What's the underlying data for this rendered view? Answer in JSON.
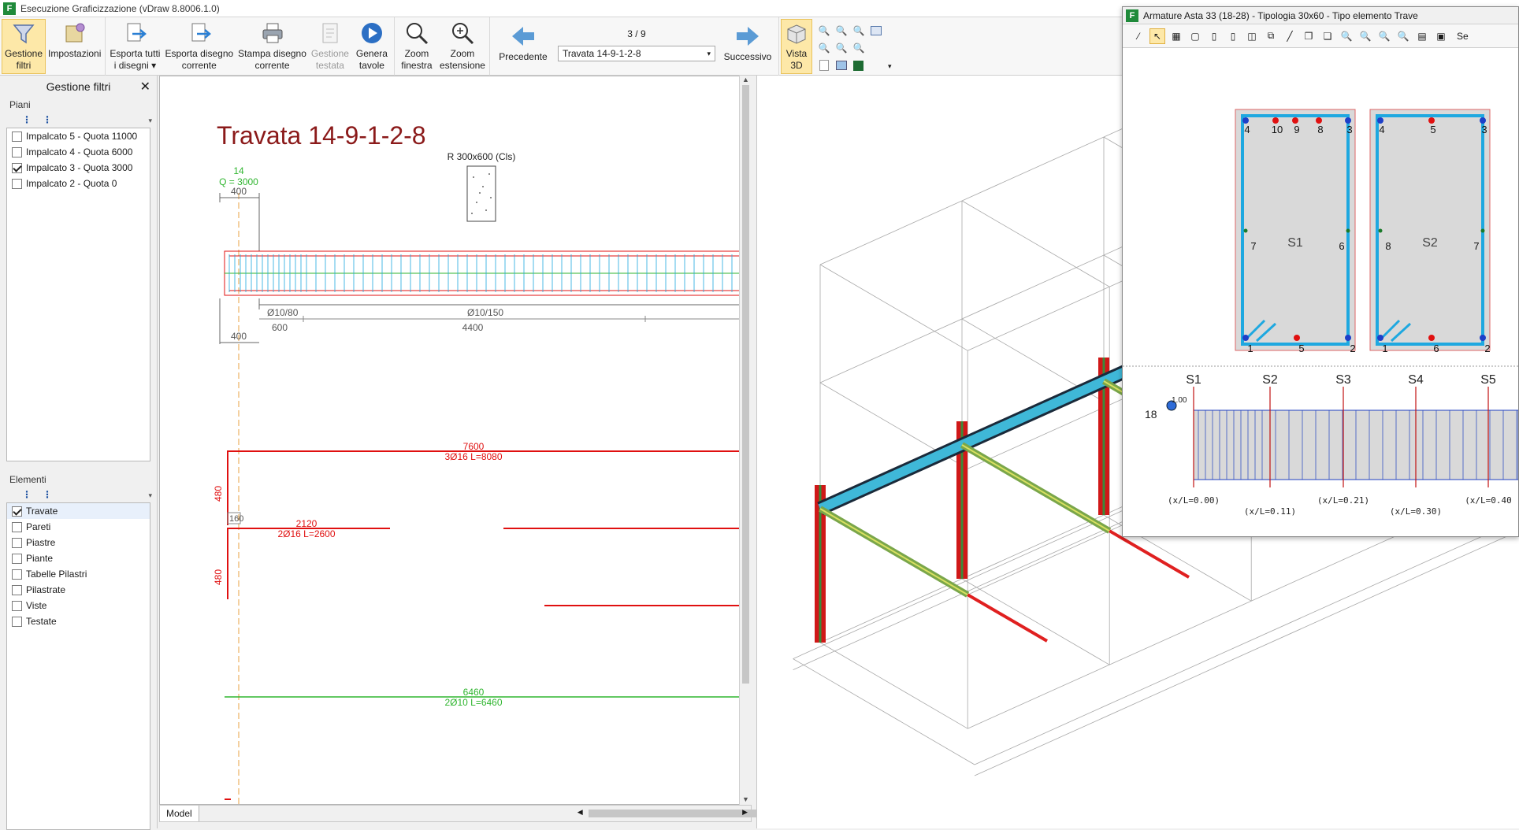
{
  "window": {
    "title": "Esecuzione Graficizzazione (vDraw 8.8006.1.0)",
    "icon_letter": "F"
  },
  "ribbon": {
    "buttons": [
      {
        "label1": "Gestione",
        "label2": "filtri",
        "icon": "filter-icon"
      },
      {
        "label1": "Impostazioni",
        "label2": "",
        "icon": "settings-icon"
      },
      {
        "label1": "Esporta tutti",
        "label2": "i disegni ▾",
        "icon": "export-all-icon"
      },
      {
        "label1": "Esporta disegno",
        "label2": "corrente",
        "icon": "export-current-icon"
      },
      {
        "label1": "Stampa disegno",
        "label2": "corrente",
        "icon": "print-icon"
      },
      {
        "label1": "Gestione",
        "label2": "testata",
        "icon": "header-icon"
      },
      {
        "label1": "Genera",
        "label2": "tavole",
        "icon": "play-icon"
      },
      {
        "label1": "Zoom",
        "label2": "finestra",
        "icon": "zoom-window-icon"
      },
      {
        "label1": "Zoom",
        "label2": "estensione",
        "icon": "zoom-extent-icon"
      }
    ],
    "nav": {
      "prev_label": "Precedente",
      "next_label": "Successivo",
      "counter": "3 / 9",
      "selected": "Travata 14-9-1-2-8"
    },
    "view3d": {
      "label1": "Vista",
      "label2": "3D"
    }
  },
  "filters": {
    "title": "Gestione filtri",
    "piani_label": "Piani",
    "piani": [
      {
        "label": "Impalcato 5 - Quota 11000",
        "checked": false
      },
      {
        "label": "Impalcato 4 - Quota 6000",
        "checked": false
      },
      {
        "label": "Impalcato 3 - Quota 3000",
        "checked": true
      },
      {
        "label": "Impalcato 2 - Quota 0",
        "checked": false
      }
    ],
    "elementi_label": "Elementi",
    "elementi": [
      {
        "label": "Travate",
        "checked": true
      },
      {
        "label": "Pareti",
        "checked": false
      },
      {
        "label": "Piastre",
        "checked": false
      },
      {
        "label": "Piante",
        "checked": false
      },
      {
        "label": "Tabelle Pilastri",
        "checked": false
      },
      {
        "label": "Pilastrate",
        "checked": false
      },
      {
        "label": "Viste",
        "checked": false
      },
      {
        "label": "Testate",
        "checked": false
      }
    ]
  },
  "drawing": {
    "title": "Travata 14-9-1-2-8",
    "section_label": "R 300x600 (Cls)",
    "node_label": "14",
    "quota_label": "Q = 3000",
    "dim_400_top": "400",
    "dim_400_bot": "400",
    "stirrup1": "Ø10/80",
    "stirrup2": "Ø10/150",
    "len1": "600",
    "len2": "4400",
    "bar1_len": "7600",
    "bar1_desc": "3Ø16 L=8080",
    "bar2_len": "2120",
    "bar2_desc": "2Ø16 L=2600",
    "bar3_len": "6460",
    "bar3_desc": "2Ø10 L=6460",
    "side_480a": "480",
    "side_480b": "480",
    "side_160": "160",
    "model_tab": "Model"
  },
  "floating": {
    "title": "Armature Asta 33 (18-28) - Tipologia 30x60 - Tipo elemento Trave",
    "toolbar_tail": "Se",
    "s1": {
      "name": "S1",
      "top": [
        "4",
        "10",
        "9",
        "8",
        "3"
      ],
      "mid": [
        "7",
        "6"
      ],
      "bot": [
        "1",
        "5",
        "2"
      ]
    },
    "s2": {
      "name": "S2",
      "top": [
        "4",
        "5",
        "3"
      ],
      "mid": [
        "8",
        "7"
      ],
      "bot": [
        "1",
        "6",
        "2"
      ]
    },
    "node": "18",
    "node_val": "1.00",
    "sections": [
      {
        "name": "S1",
        "xl": "(x/L=0.00)"
      },
      {
        "name": "S2",
        "xl": "(x/L=0.11)"
      },
      {
        "name": "S3",
        "xl": "(x/L=0.21)"
      },
      {
        "name": "S4",
        "xl": "(x/L=0.30)"
      },
      {
        "name": "S5",
        "xl": "(x/L=0.40"
      }
    ]
  },
  "colors": {
    "title_red": "#8b1a1a",
    "rebar_red": "#e01010",
    "green": "#2fb52f",
    "cyan": "#1ea8e0",
    "blue": "#2040c0"
  }
}
